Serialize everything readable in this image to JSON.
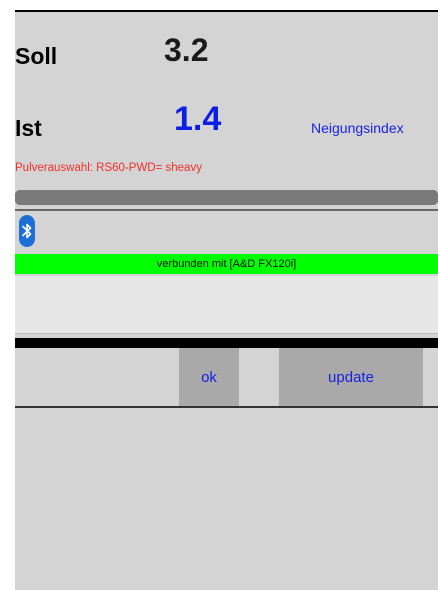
{
  "soll": {
    "label": "Soll",
    "value": "3.2"
  },
  "ist": {
    "label": "Ist",
    "value": "1.4"
  },
  "neigungsindex_label": "Neigungsindex",
  "pulverauswahl": "Pulverauswahl: RS60-PWD= sheavy",
  "progress": {
    "fraction": 1.0
  },
  "bluetooth": {
    "icon": "bluetooth-icon"
  },
  "status": {
    "text": "verbunden mit [A&D FX120i]",
    "color": "#00ff00"
  },
  "text_area_value": "",
  "buttons": {
    "ok": "ok",
    "update": "update"
  },
  "colors": {
    "accent": "#1a22e0",
    "ist_value": "#0a1ee6",
    "warning_text": "#f0302c",
    "background": "#d4d4d4"
  }
}
